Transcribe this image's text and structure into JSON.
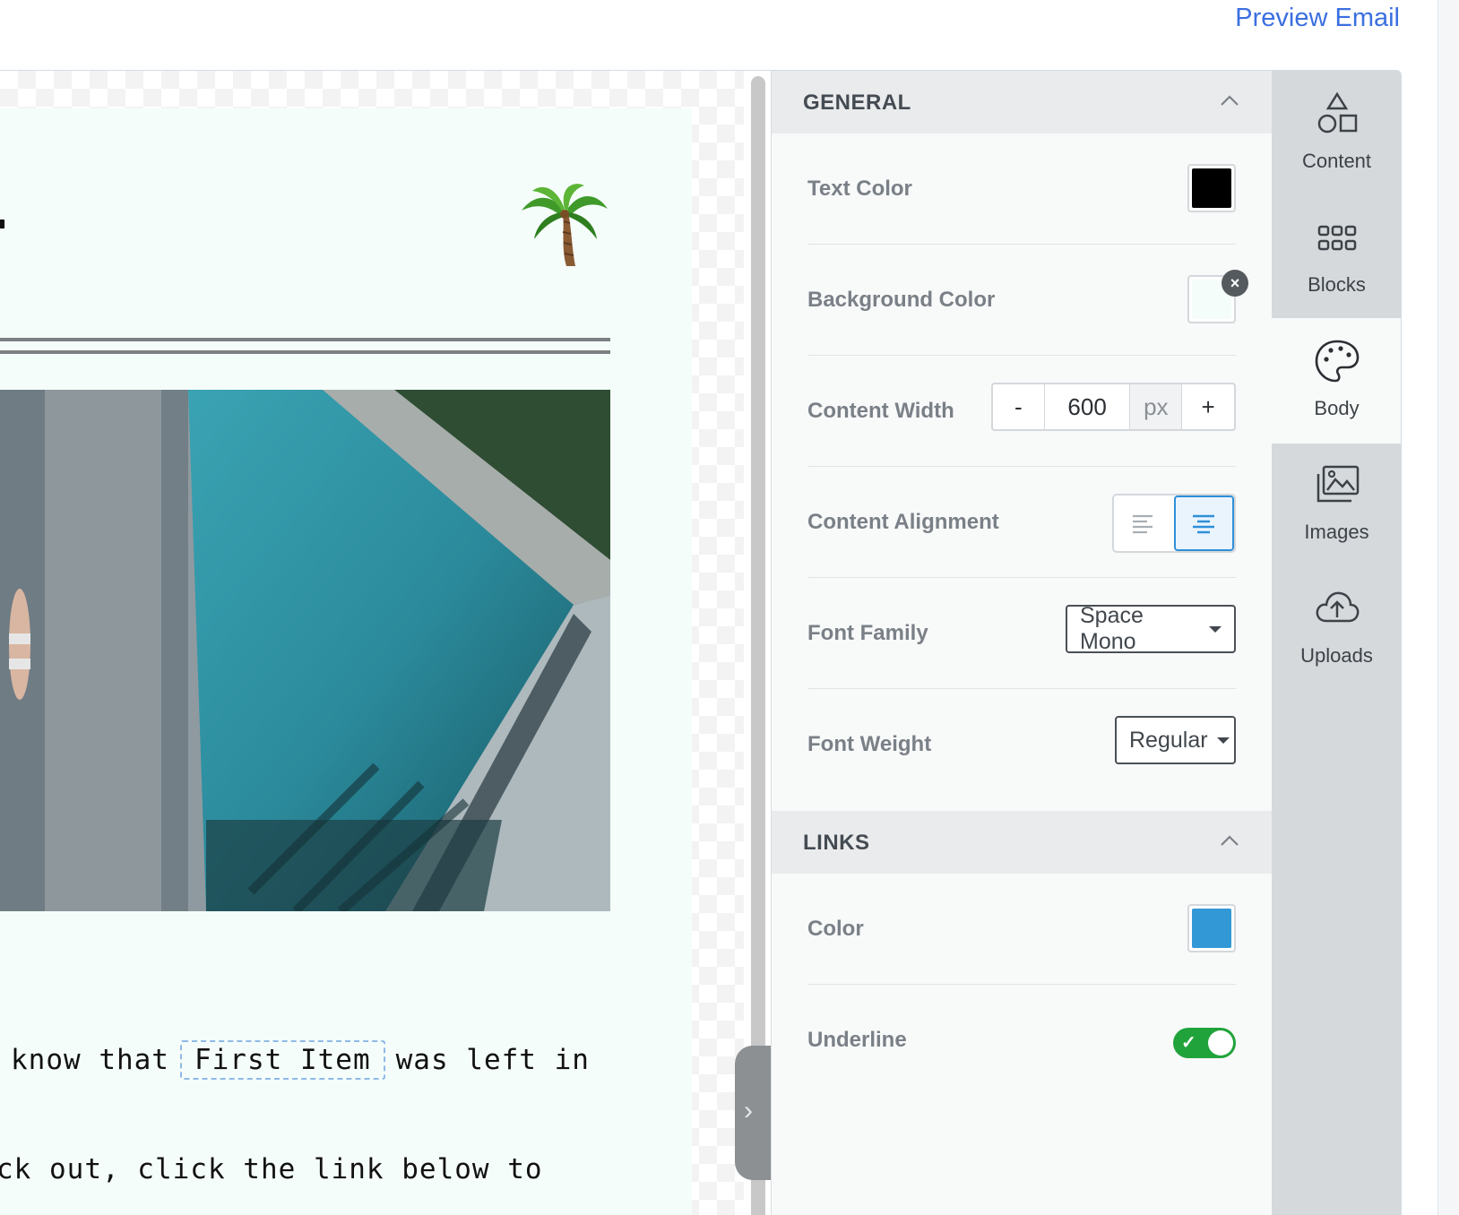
{
  "header": {
    "preview_link": "Preview Email"
  },
  "canvas": {
    "palm_emoji": "🌴",
    "body_line1_before": "know that",
    "merge_tag": "First Item",
    "body_line1_after": "was left in",
    "body_line2": "ck out, click the link below to",
    "email_background": "#f5fdfa"
  },
  "panel": {
    "general": {
      "title": "GENERAL",
      "text_color_label": "Text Color",
      "text_color": "#000000",
      "background_color_label": "Background Color",
      "background_color": "#f5fdfa",
      "content_width_label": "Content Width",
      "content_width_minus": "-",
      "content_width_value": "600",
      "content_width_unit": "px",
      "content_width_plus": "+",
      "content_alignment_label": "Content Alignment",
      "content_alignment_selected": "center",
      "font_family_label": "Font Family",
      "font_family_value": "Space Mono",
      "font_weight_label": "Font Weight",
      "font_weight_value": "Regular"
    },
    "links": {
      "title": "LINKS",
      "color_label": "Color",
      "color": "#3399d6",
      "underline_label": "Underline",
      "underline_on": true
    }
  },
  "rail": {
    "items": [
      {
        "label": "Content",
        "icon": "shapes-icon"
      },
      {
        "label": "Blocks",
        "icon": "grid-icon"
      },
      {
        "label": "Body",
        "icon": "palette-icon",
        "active": true
      },
      {
        "label": "Images",
        "icon": "images-icon"
      },
      {
        "label": "Uploads",
        "icon": "cloud-upload-icon"
      }
    ]
  },
  "colors": {
    "accent": "#3b6fe0",
    "toggle_on": "#21a33c",
    "alignment_active": "#2f8fd8"
  }
}
